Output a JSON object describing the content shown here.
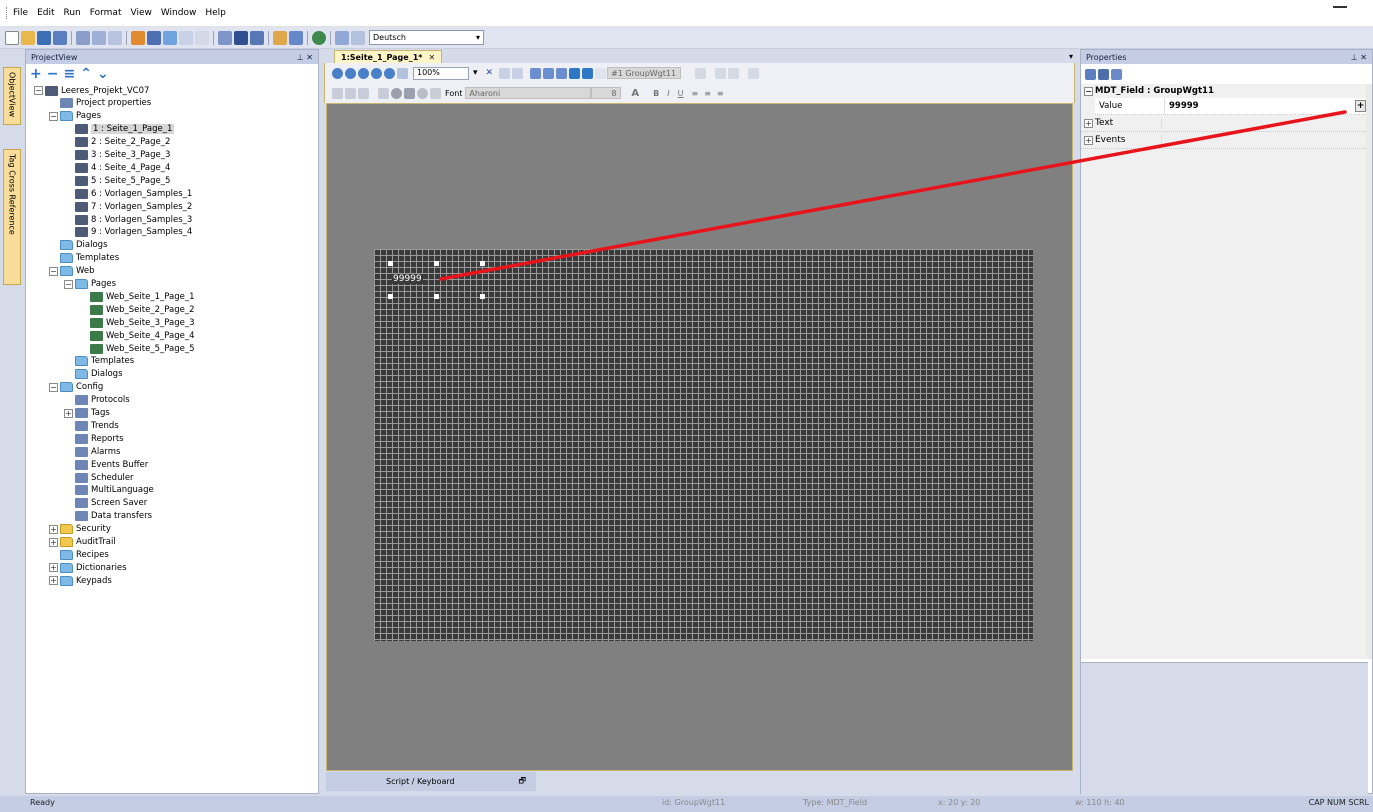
{
  "menu": [
    "File",
    "Edit",
    "Run",
    "Format",
    "View",
    "Window",
    "Help"
  ],
  "toolbar": {
    "language": "Deutsch"
  },
  "side_tabs": {
    "object_view": "ObjectView",
    "tag_cross": "Tag Cross Reference"
  },
  "projectview": {
    "title": "ProjectView",
    "tools": [
      "+",
      "−",
      "≡",
      "⌃",
      "⌄"
    ],
    "tree": [
      {
        "label": "Leeres_Projekt_VC07",
        "level": 0,
        "exp": "−",
        "icon": "page"
      },
      {
        "label": "Project properties",
        "level": 1,
        "exp": "",
        "icon": "misc"
      },
      {
        "label": "Pages",
        "level": 1,
        "exp": "−",
        "icon": "folder"
      },
      {
        "label": "1 : Seite_1_Page_1",
        "level": 2,
        "exp": "",
        "icon": "page",
        "selected": true
      },
      {
        "label": "2 : Seite_2_Page_2",
        "level": 2,
        "exp": "",
        "icon": "page"
      },
      {
        "label": "3 : Seite_3_Page_3",
        "level": 2,
        "exp": "",
        "icon": "page"
      },
      {
        "label": "4 : Seite_4_Page_4",
        "level": 2,
        "exp": "",
        "icon": "page"
      },
      {
        "label": "5 : Seite_5_Page_5",
        "level": 2,
        "exp": "",
        "icon": "page"
      },
      {
        "label": "6 : Vorlagen_Samples_1",
        "level": 2,
        "exp": "",
        "icon": "page"
      },
      {
        "label": "7 : Vorlagen_Samples_2",
        "level": 2,
        "exp": "",
        "icon": "page"
      },
      {
        "label": "8 : Vorlagen_Samples_3",
        "level": 2,
        "exp": "",
        "icon": "page"
      },
      {
        "label": "9 : Vorlagen_Samples_4",
        "level": 2,
        "exp": "",
        "icon": "page"
      },
      {
        "label": "Dialogs",
        "level": 1,
        "exp": "",
        "icon": "folder"
      },
      {
        "label": "Templates",
        "level": 1,
        "exp": "",
        "icon": "folder"
      },
      {
        "label": "Web",
        "level": 1,
        "exp": "−",
        "icon": "folder"
      },
      {
        "label": "Pages",
        "level": 2,
        "exp": "−",
        "icon": "folder"
      },
      {
        "label": "Web_Seite_1_Page_1",
        "level": 3,
        "exp": "",
        "icon": "web"
      },
      {
        "label": "Web_Seite_2_Page_2",
        "level": 3,
        "exp": "",
        "icon": "web"
      },
      {
        "label": "Web_Seite_3_Page_3",
        "level": 3,
        "exp": "",
        "icon": "web"
      },
      {
        "label": "Web_Seite_4_Page_4",
        "level": 3,
        "exp": "",
        "icon": "web"
      },
      {
        "label": "Web_Seite_5_Page_5",
        "level": 3,
        "exp": "",
        "icon": "web"
      },
      {
        "label": "Templates",
        "level": 2,
        "exp": "",
        "icon": "folder"
      },
      {
        "label": "Dialogs",
        "level": 2,
        "exp": "",
        "icon": "folder"
      },
      {
        "label": "Config",
        "level": 1,
        "exp": "−",
        "icon": "folder"
      },
      {
        "label": "Protocols",
        "level": 2,
        "exp": "",
        "icon": "misc"
      },
      {
        "label": "Tags",
        "level": 2,
        "exp": "+",
        "icon": "misc"
      },
      {
        "label": "Trends",
        "level": 2,
        "exp": "",
        "icon": "misc"
      },
      {
        "label": "Reports",
        "level": 2,
        "exp": "",
        "icon": "misc"
      },
      {
        "label": "Alarms",
        "level": 2,
        "exp": "",
        "icon": "misc"
      },
      {
        "label": "Events Buffer",
        "level": 2,
        "exp": "",
        "icon": "misc"
      },
      {
        "label": "Scheduler",
        "level": 2,
        "exp": "",
        "icon": "misc"
      },
      {
        "label": "MultiLanguage",
        "level": 2,
        "exp": "",
        "icon": "misc"
      },
      {
        "label": "Screen Saver",
        "level": 2,
        "exp": "",
        "icon": "misc"
      },
      {
        "label": "Data transfers",
        "level": 2,
        "exp": "",
        "icon": "misc"
      },
      {
        "label": "Security",
        "level": 1,
        "exp": "+",
        "icon": "yellow"
      },
      {
        "label": "AuditTrail",
        "level": 1,
        "exp": "+",
        "icon": "yellow"
      },
      {
        "label": "Recipes",
        "level": 1,
        "exp": "",
        "icon": "folder"
      },
      {
        "label": "Dictionaries",
        "level": 1,
        "exp": "+",
        "icon": "folder"
      },
      {
        "label": "Keypads",
        "level": 1,
        "exp": "+",
        "icon": "folder"
      }
    ]
  },
  "editor": {
    "tab_label": "1:Seite_1_Page_1*",
    "zoom": "100%",
    "group_name": "#1 GroupWgt11",
    "font_label": "Font",
    "font_name": "Aharoni",
    "font_size": "8",
    "field_value": "99999",
    "bottom_tab": "Script / Keyboard"
  },
  "properties": {
    "title": "Properties",
    "group": "MDT_Field : GroupWgt11",
    "value_name": "Value",
    "value": "99999",
    "sub_text": "Text",
    "sub_events": "Events"
  },
  "status": {
    "ready": "Ready",
    "id": "id:  GroupWgt11",
    "type": "Type:  MDT_Field",
    "xy": "x: 20    y: 20",
    "wh": "w: 110    h: 40",
    "cap": "CAP  NUM  SCRL"
  },
  "colors": {
    "annotation": "#e8141b",
    "grid_bg": "#3a3a3a",
    "canvas": "#808080"
  }
}
